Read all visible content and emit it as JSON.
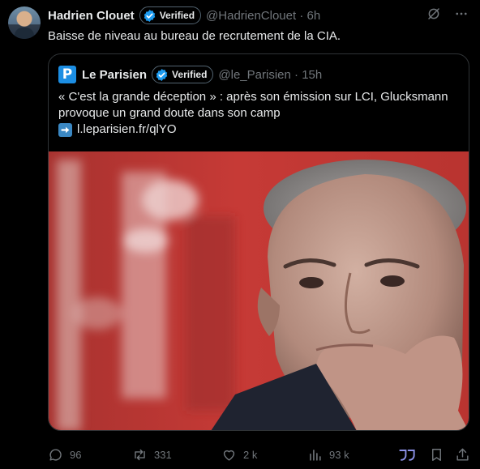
{
  "author": {
    "name": "Hadrien Clouet",
    "verified_label": "Verified",
    "handle": "@HadrienClouet",
    "time": "6h"
  },
  "tweet_text": "Baisse de niveau au bureau de recrutement de la CIA.",
  "quoted": {
    "logo_letter": "P",
    "name": "Le Parisien",
    "verified_label": "Verified",
    "handle": "@le_Parisien",
    "time": "15h",
    "text": "« C'est la grande déception » : après son émission sur LCI, Glucksmann provoque un grand doute dans son camp",
    "link": "l.leparisien.fr/qlYO"
  },
  "actions": {
    "replies": "96",
    "reposts": "331",
    "likes": "2 k",
    "views": "93 k"
  },
  "colors": {
    "background": "#000000",
    "text": "#e7e9ea",
    "muted": "#71767b",
    "verified_blue": "#1d9bf0",
    "parisien_blue": "#1c8ee3",
    "photo_red": "#c63a36"
  },
  "icons": [
    "grok-icon",
    "more-icon",
    "verified-badge-icon",
    "arrow-right-icon",
    "reply-icon",
    "repost-icon",
    "like-icon",
    "views-icon",
    "grok-quote-icon",
    "bookmark-icon",
    "share-icon"
  ]
}
